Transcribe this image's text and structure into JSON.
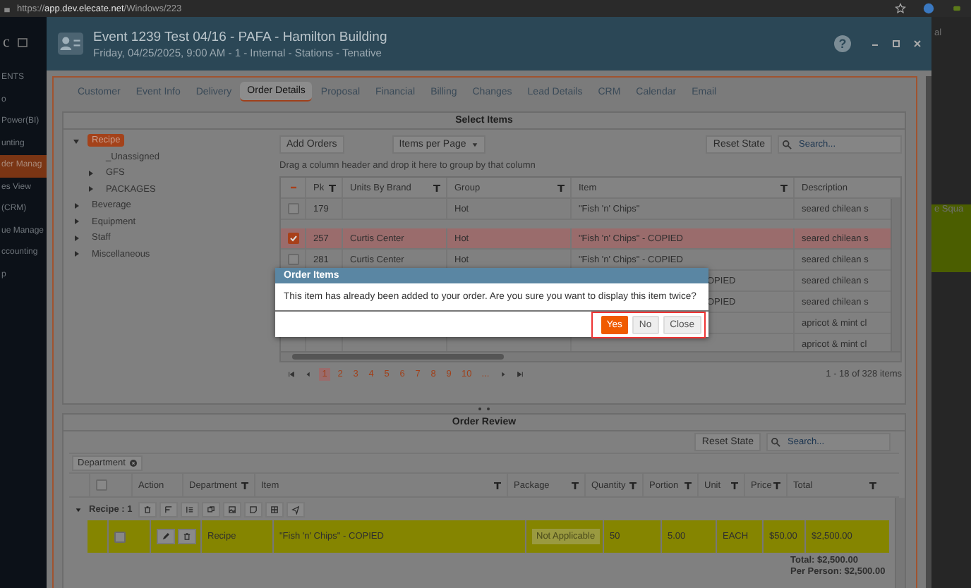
{
  "browser": {
    "url": "https://**app.dev.elecate.net**/Windows/223"
  },
  "background_app": {
    "logo": "c",
    "sidebar_items": [
      {
        "label": "ENTS",
        "selected": false
      },
      {
        "label": "o",
        "selected": false
      },
      {
        "label": "Power(BI)",
        "selected": false
      },
      {
        "label": "unting",
        "selected": false
      },
      {
        "label": "der Manag",
        "selected": true
      },
      {
        "label": "es View",
        "selected": false
      },
      {
        "label": "(CRM)",
        "selected": false
      },
      {
        "label": "ue Manage",
        "selected": false
      },
      {
        "label": "ccounting",
        "selected": false
      },
      {
        "label": "p",
        "selected": false
      }
    ],
    "right_texts": [
      "al",
      "e Squa"
    ]
  },
  "window": {
    "title": "Event 1239 Test 04/16 - PAFA - Hamilton Building",
    "subtitle": "Friday, 04/25/2025, 9:00 AM - 1 - Internal - Stations - Tenative",
    "help": "?"
  },
  "tabs": [
    {
      "label": "Customer",
      "selected": false
    },
    {
      "label": "Event Info",
      "selected": false
    },
    {
      "label": "Delivery",
      "selected": false
    },
    {
      "label": "Order Details",
      "selected": true
    },
    {
      "label": "Proposal",
      "selected": false
    },
    {
      "label": "Financial",
      "selected": false
    },
    {
      "label": "Billing",
      "selected": false
    },
    {
      "label": "Changes",
      "selected": false
    },
    {
      "label": "Lead Details",
      "selected": false
    },
    {
      "label": "CRM",
      "selected": false
    },
    {
      "label": "Calendar",
      "selected": false
    },
    {
      "label": "Email",
      "selected": false
    }
  ],
  "select_items": {
    "title": "Select Items",
    "tree": [
      {
        "label": "Recipe",
        "kind": "branch",
        "expanded": true,
        "selected": true,
        "children": [
          {
            "label": "_Unassigned",
            "kind": "leaf",
            "selected": false
          },
          {
            "label": "GFS",
            "kind": "branch",
            "expanded": false,
            "selected": false
          },
          {
            "label": "PACKAGES",
            "kind": "branch",
            "expanded": false,
            "selected": false
          }
        ]
      },
      {
        "label": "Beverage",
        "kind": "branch",
        "expanded": false,
        "selected": false
      },
      {
        "label": "Equipment",
        "kind": "branch",
        "expanded": false,
        "selected": false
      },
      {
        "label": "Staff",
        "kind": "branch",
        "expanded": false,
        "selected": false
      },
      {
        "label": "Miscellaneous",
        "kind": "branch",
        "expanded": false,
        "selected": false
      }
    ],
    "add_orders": "Add Orders",
    "items_per_page": "Items per Page",
    "reset_state": "Reset State",
    "search_placeholder": "Search...",
    "group_hint": "Drag a column header and drop it here to group by that column",
    "columns": [
      {
        "label": "Pk",
        "filter": true
      },
      {
        "label": "Units By Brand",
        "filter": true
      },
      {
        "label": "Group",
        "filter": true
      },
      {
        "label": "Item",
        "filter": true
      },
      {
        "label": "Description",
        "filter": false
      }
    ],
    "rows": [
      {
        "checked": false,
        "selected": false,
        "pk": "179",
        "group": "Hot",
        "item": "\"Fish 'n' Chips\"",
        "description": "seared chilean s"
      },
      {
        "checked": true,
        "selected": true,
        "pk": "257",
        "units": "Curtis Center",
        "group": "Hot",
        "item": "\"Fish 'n' Chips\" - COPIED",
        "description": "seared chilean s"
      },
      {
        "checked": false,
        "selected": false,
        "pk": "281",
        "units": "Curtis Center",
        "group": "Hot",
        "item": "\"Fish 'n' Chips\" - COPIED",
        "description": "seared chilean s"
      },
      {
        "selected": false,
        "item": "OPIED",
        "description": "seared chilean s"
      },
      {
        "selected": false,
        "item": "OPIED",
        "description": "seared chilean s"
      },
      {
        "selected": false,
        "description": "apricot & mint cl"
      },
      {
        "selected": false,
        "description": "apricot & mint cl"
      }
    ],
    "pager": {
      "pages": [
        {
          "label": "1",
          "selected": true
        },
        {
          "label": "2",
          "selected": false
        },
        {
          "label": "3",
          "selected": false
        },
        {
          "label": "4",
          "selected": false
        },
        {
          "label": "5",
          "selected": false
        },
        {
          "label": "6",
          "selected": false
        },
        {
          "label": "7",
          "selected": false
        },
        {
          "label": "8",
          "selected": false
        },
        {
          "label": "9",
          "selected": false
        },
        {
          "label": "10",
          "selected": false
        },
        {
          "label": "...",
          "selected": false
        }
      ],
      "summary": "1 - 18 of 328 items"
    }
  },
  "order_review": {
    "title": "Order Review",
    "select_all_checked": false,
    "reset_state": "Reset State",
    "search_placeholder": "Search...",
    "group_chip": "Department",
    "columns": [
      {
        "label": "Action",
        "filter": false
      },
      {
        "label": "Department",
        "filter": true
      },
      {
        "label": "Item",
        "filter": true
      },
      {
        "label": "Package",
        "filter": true
      },
      {
        "label": "Quantity",
        "filter": true
      },
      {
        "label": "Portion",
        "filter": true
      },
      {
        "label": "Unit",
        "filter": true
      },
      {
        "label": "Price",
        "filter": true
      },
      {
        "label": "Total",
        "filter": true
      }
    ],
    "group": {
      "label": "Recipe : 1",
      "expanded": true
    },
    "rows": [
      {
        "checked": false,
        "department": "Recipe",
        "item": "\"Fish 'n' Chips\" - COPIED",
        "package": "Not Applicable",
        "quantity": "50",
        "portion": "5.00",
        "unit": "EACH",
        "price": "$50.00",
        "total": "$2,500.00"
      }
    ],
    "total": "Total: $2,500.00",
    "per_person": "Per Person: $2,500.00"
  },
  "dialog": {
    "title": "Order Items",
    "message": "This item has already been added to your order. Are you sure you want to display this item twice?",
    "buttons": [
      {
        "label": "Yes",
        "kind": "primary"
      },
      {
        "label": "No",
        "kind": "default"
      },
      {
        "label": "Close",
        "kind": "default"
      }
    ]
  }
}
